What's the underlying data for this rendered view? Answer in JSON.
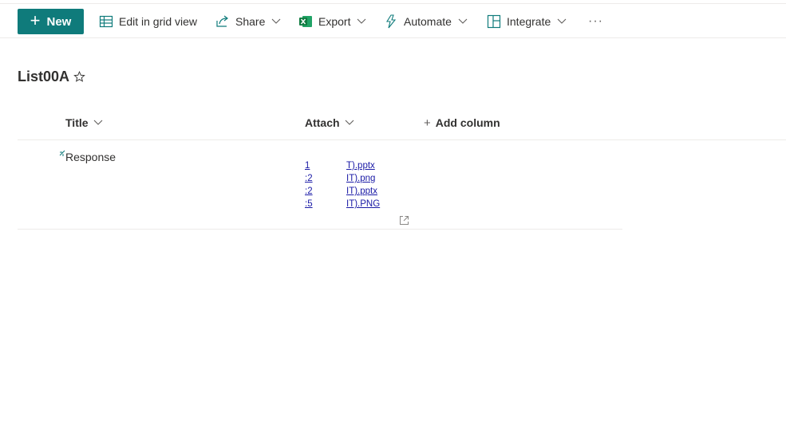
{
  "commandbar": {
    "new_label": "New",
    "items": [
      {
        "label": "Edit in grid view",
        "icon": "grid-icon"
      },
      {
        "label": "Share",
        "icon": "share-icon"
      },
      {
        "label": "Export",
        "icon": "excel-icon"
      },
      {
        "label": "Automate",
        "icon": "automate-icon"
      },
      {
        "label": "Integrate",
        "icon": "integrate-icon"
      }
    ],
    "more_label": "···"
  },
  "list": {
    "title": "List00A",
    "columns": [
      {
        "label": "Title"
      },
      {
        "label": "Attach"
      }
    ],
    "add_column_label": "Add column",
    "rows": [
      {
        "title": "Response",
        "attachments": [
          {
            "a": "1",
            "b": "T).pptx"
          },
          {
            "a": ":2",
            "b": "IT).png"
          },
          {
            "a": ":2",
            "b": "IT).pptx"
          },
          {
            "a": ":5",
            "b": "IT).PNG"
          }
        ]
      }
    ]
  },
  "colors": {
    "accent": "#0f7b7b",
    "link": "#1a1aa6",
    "excel": "#107c41"
  }
}
